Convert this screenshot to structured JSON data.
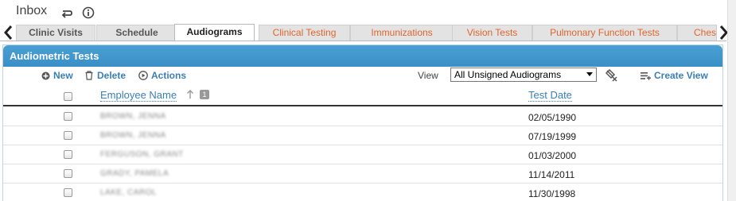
{
  "header": {
    "title": "Inbox"
  },
  "tabs": [
    {
      "label": "Clinic Visits",
      "active": false,
      "style": "gray"
    },
    {
      "label": "Schedule",
      "active": false,
      "style": "gray"
    },
    {
      "label": "Audiograms",
      "active": true,
      "style": "active"
    },
    {
      "label": "Clinical Testing",
      "active": false,
      "style": "orange"
    },
    {
      "label": "Immunizations",
      "active": false,
      "style": "orange"
    },
    {
      "label": "Vision Tests",
      "active": false,
      "style": "orange"
    },
    {
      "label": "Pulmonary Function Tests",
      "active": false,
      "style": "orange"
    },
    {
      "label": "Ches",
      "active": false,
      "style": "orange"
    }
  ],
  "panel": {
    "title": "Audiometric Tests"
  },
  "toolbar": {
    "new_label": "New",
    "delete_label": "Delete",
    "actions_label": "Actions",
    "view_label": "View",
    "view_selected": "All Unsigned Audiograms",
    "create_view_label": "Create View"
  },
  "grid": {
    "columns": {
      "employee_name": "Employee Name",
      "test_date": "Test Date"
    },
    "sort_badge": "1",
    "rows": [
      {
        "employee": "BROWN, JENNA",
        "date": "02/05/1990"
      },
      {
        "employee": "BROWN, JENNA",
        "date": "07/19/1999"
      },
      {
        "employee": "FERGUSON, GRANT",
        "date": "01/03/2000"
      },
      {
        "employee": "GRADY, PAMELA",
        "date": "11/14/2011"
      },
      {
        "employee": "LAKE, CAROL",
        "date": "11/30/1998"
      }
    ]
  },
  "colors": {
    "header_blue": "#3a8fc6",
    "link_blue": "#3a7fb6",
    "tab_orange": "#e0642b"
  }
}
